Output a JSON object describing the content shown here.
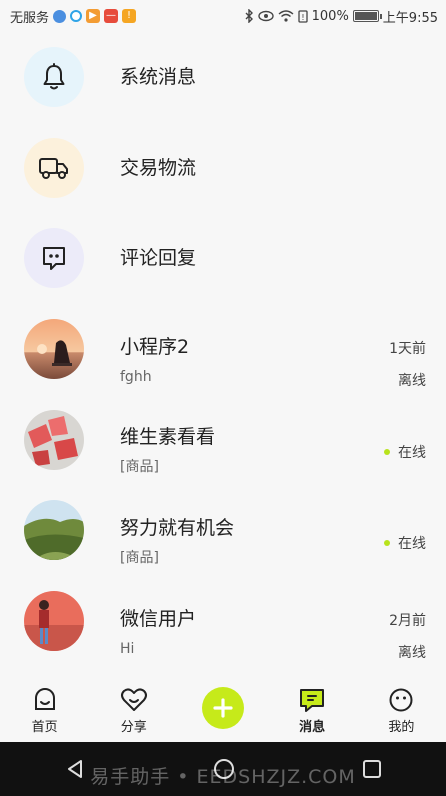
{
  "status_bar": {
    "carrier": "无服务",
    "battery": "100%",
    "time": "上午9:55"
  },
  "system_rows": [
    {
      "title": "系统消息",
      "icon": "bell-icon",
      "bg": "#e6f4fb"
    },
    {
      "title": "交易物流",
      "icon": "truck-icon",
      "bg": "#fcf1dc"
    },
    {
      "title": "评论回复",
      "icon": "comment-icon",
      "bg": "#ecebf9"
    }
  ],
  "chats": [
    {
      "name": "小程序2",
      "preview": "fghh",
      "time": "1天前",
      "status": "离线",
      "online": false
    },
    {
      "name": "维生素看看",
      "preview": "[商品]",
      "time": "",
      "status": "在线",
      "online": true
    },
    {
      "name": "努力就有机会",
      "preview": "[商品]",
      "time": "",
      "status": "在线",
      "online": true
    },
    {
      "name": "微信用户",
      "preview": "Hi",
      "time": "2月前",
      "status": "离线",
      "online": false
    }
  ],
  "tabs": {
    "home": "首页",
    "share": "分享",
    "messages": "消息",
    "mine": "我的"
  },
  "colors": {
    "accent": "#c6ea1a",
    "online": "#b8e31c"
  },
  "watermark": "易手助手 • EEDSHZJZ.COM"
}
